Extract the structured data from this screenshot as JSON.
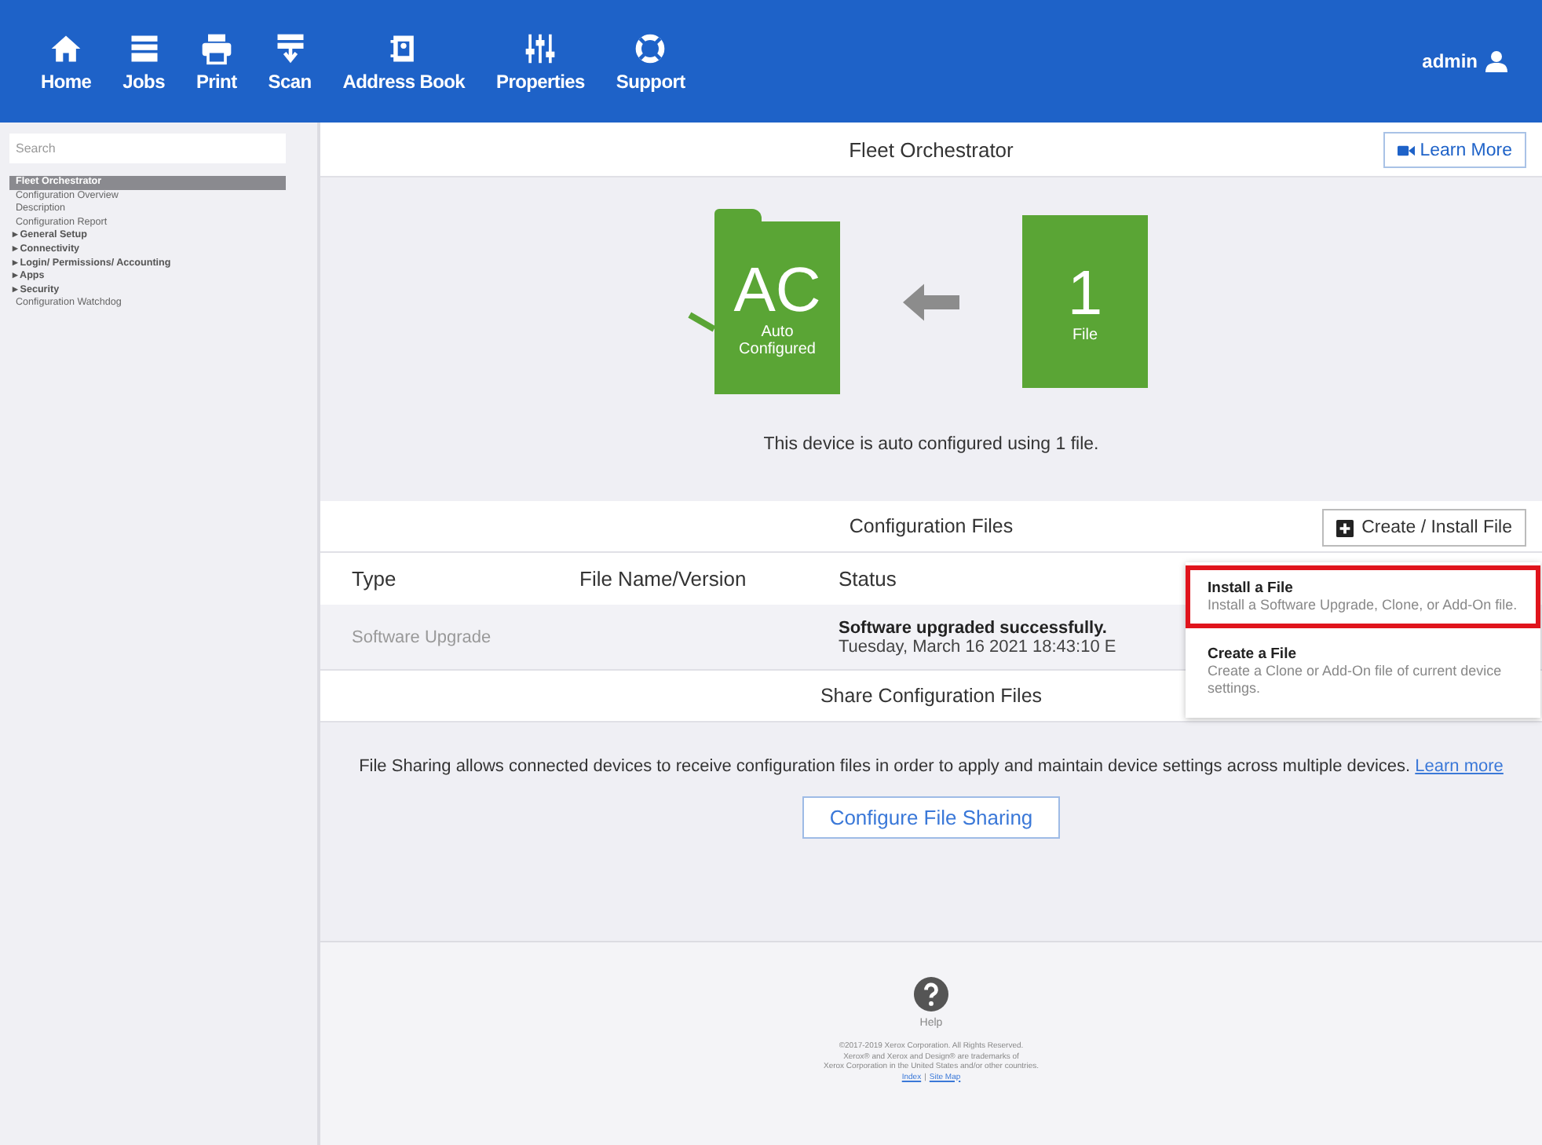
{
  "nav": {
    "items": [
      {
        "label": "Home"
      },
      {
        "label": "Jobs"
      },
      {
        "label": "Print"
      },
      {
        "label": "Scan"
      },
      {
        "label": "Address Book"
      },
      {
        "label": "Properties"
      },
      {
        "label": "Support"
      }
    ],
    "user": "admin"
  },
  "sidebar": {
    "search_placeholder": "Search",
    "items": [
      {
        "label": "Fleet Orchestrator",
        "selected": true,
        "kind": "child"
      },
      {
        "label": "Configuration Overview",
        "selected": false,
        "kind": "child"
      },
      {
        "label": "Description",
        "selected": false,
        "kind": "child"
      },
      {
        "label": "Configuration Report",
        "selected": false,
        "kind": "child"
      },
      {
        "label": "▸ General Setup",
        "selected": false,
        "kind": "group"
      },
      {
        "label": "▸ Connectivity",
        "selected": false,
        "kind": "group"
      },
      {
        "label": "▸ Login/ Permissions/ Accounting",
        "selected": false,
        "kind": "group"
      },
      {
        "label": "▸ Apps",
        "selected": false,
        "kind": "group"
      },
      {
        "label": "▸ Security",
        "selected": false,
        "kind": "group"
      },
      {
        "label": "Configuration Watchdog",
        "selected": false,
        "kind": "child"
      }
    ]
  },
  "page": {
    "title": "Fleet Orchestrator",
    "learn_more_button": "Learn More",
    "tiles": [
      {
        "big": "AC",
        "caption": "Auto Configured"
      },
      {
        "big": "1",
        "caption": "File"
      }
    ],
    "summary": "This device is auto configured using 1 file.",
    "config_files": {
      "title": "Configuration Files",
      "button": "Create / Install File",
      "columns": [
        "Type",
        "File Name/Version",
        "Status"
      ],
      "rows": [
        {
          "type": "Software Upgrade",
          "file": "",
          "status": "Software upgraded successfully.",
          "date": "Tuesday, March 16 2021 18:43:10 E"
        }
      ]
    },
    "menu": [
      {
        "title": "Install a File",
        "description": "Install a Software Upgrade, Clone, or Add-On file.",
        "selected": true
      },
      {
        "title": "Create a File",
        "description": "Create a Clone or Add-On file of current device settings.",
        "selected": false
      }
    ],
    "share": {
      "title": "Share Configuration Files",
      "text": "File Sharing allows connected devices to receive configuration files in order to apply and maintain device settings across multiple devices.",
      "link": "Learn more",
      "button": "Configure File Sharing"
    },
    "footer": {
      "help": "Help",
      "lines": [
        "©2017-2019 Xerox Corporation. All Rights Reserved.",
        "Xerox® and Xerox and Design® are trademarks of",
        "Xerox Corporation in the United States and/or other countries."
      ],
      "links": [
        "Index",
        "Site Map"
      ],
      "separator": "|"
    }
  }
}
